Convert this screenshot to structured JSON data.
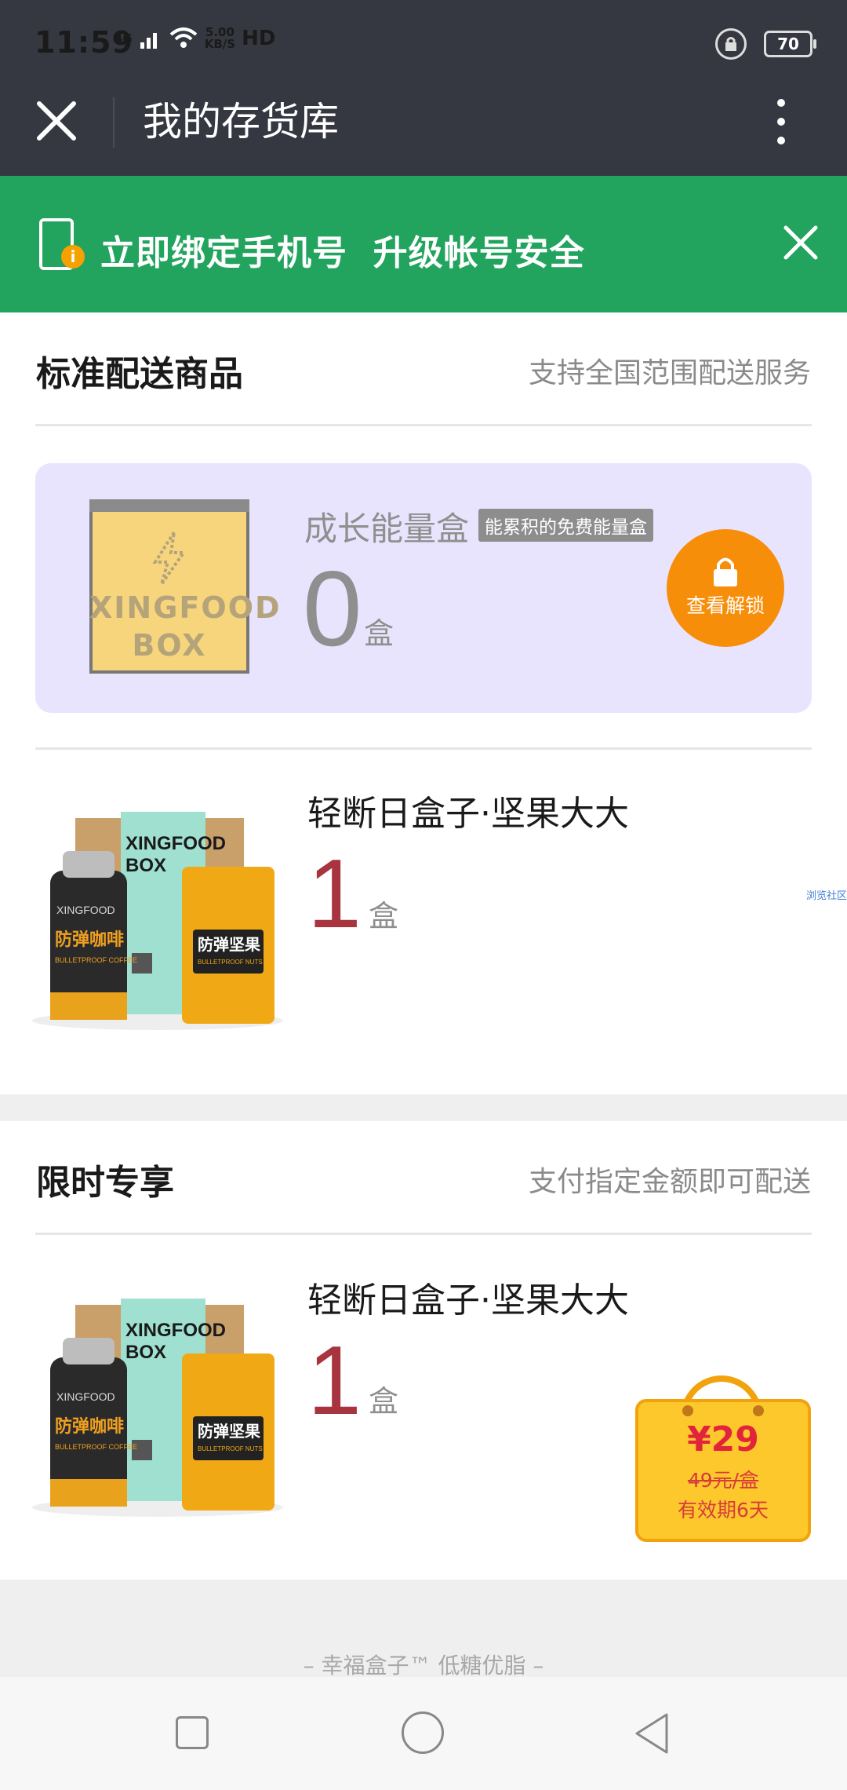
{
  "status_bar": {
    "time": "11:59",
    "network": "4G",
    "speed_value": "5.00",
    "speed_unit": "KB/S",
    "hd": "HD",
    "battery": "70"
  },
  "title_bar": {
    "title": "我的存货库",
    "icons": [
      "close-icon",
      "more-vertical-icon"
    ]
  },
  "banner": {
    "text": "立即绑定手机号  升级帐号安全",
    "bg_color": "#22a45e"
  },
  "standard_section": {
    "title": "标准配送商品",
    "note": "支持全国范围配送服务",
    "energy_box": {
      "name": "成长能量盒",
      "tag": "能累积的免费能量盒",
      "count": "0",
      "unit": "盒",
      "image_text_line1": "XINGFOOD",
      "image_text_line2": "BOX",
      "button_label": "查看解锁"
    },
    "product": {
      "name": "轻断日盒子·坚果大大",
      "count": "1",
      "unit": "盒"
    }
  },
  "limited_section": {
    "title": "限时专享",
    "note": "支付指定金额即可配送",
    "product": {
      "name": "轻断日盒子·坚果大大",
      "count": "1",
      "unit": "盒"
    },
    "price_tag": {
      "price": "¥29",
      "original": "49元/盒",
      "validity": "有效期6天"
    }
  },
  "product_image": {
    "box_line1": "XINGFOOD",
    "box_line2": "BOX",
    "bottle_brand": "XINGFOOD",
    "bottle_label": "防弹咖啡",
    "bottle_sub": "BULLETPROOF COFFEE",
    "pouch_label": "防弹坚果",
    "pouch_sub": "BULLETPROOF NUTS"
  },
  "side_link": "浏览社区",
  "footer": {
    "slogan": "– 幸福盒子™ 低糖优脂 –"
  },
  "colors": {
    "accent_orange": "#f78e0a",
    "number_red": "#a8343f",
    "card_lavender": "#e9e4fd"
  }
}
